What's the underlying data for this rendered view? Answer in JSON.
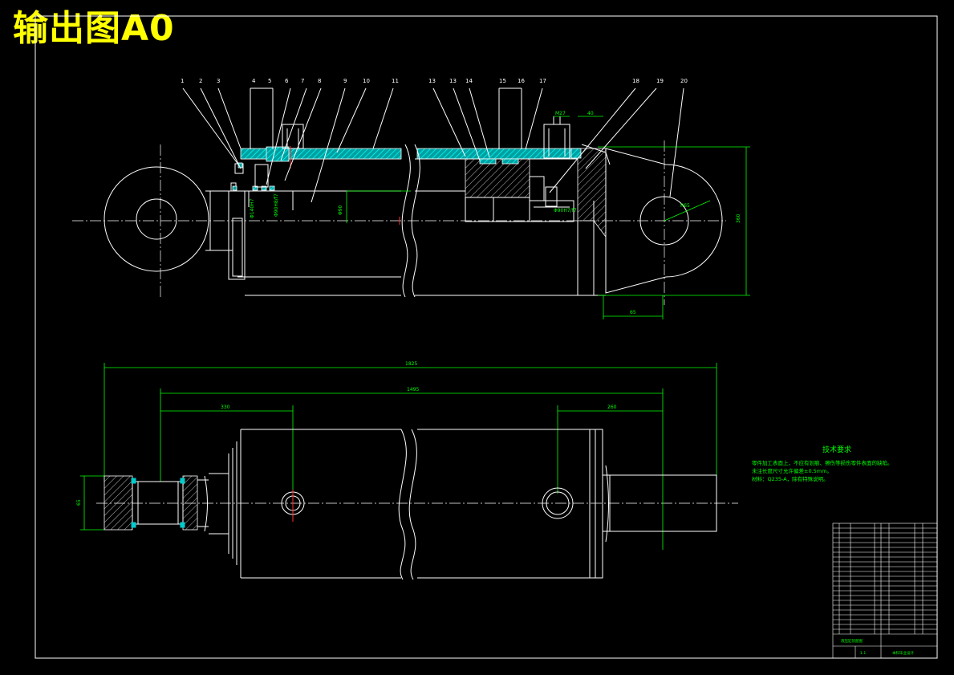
{
  "title_stamp": "输出图A0",
  "balloons": [
    "1",
    "2",
    "3",
    "4",
    "5",
    "6",
    "7",
    "8",
    "9",
    "10",
    "11",
    "13",
    "13",
    "14",
    "15",
    "16",
    "17",
    "18",
    "19",
    "20"
  ],
  "technical_requirements": {
    "heading": "技术要求",
    "lines": [
      "零件加工表面上，不应有划痕、擦伤等损伤零件表面的缺陷。",
      "未注长度尺寸允许偏差±0.5mm。",
      "材料：Q235-A，除有特殊说明。"
    ]
  },
  "title_block": {
    "name": "液压缸装配图",
    "school": "本科毕业设计",
    "scale": "1:1"
  },
  "colors": {
    "background": "#000000",
    "outline": "#ffffff",
    "dimension": "#00ff00",
    "section_hatch": "#00cccc",
    "stamp": "#ffff00",
    "centerline_mark": "#ff3030"
  }
}
